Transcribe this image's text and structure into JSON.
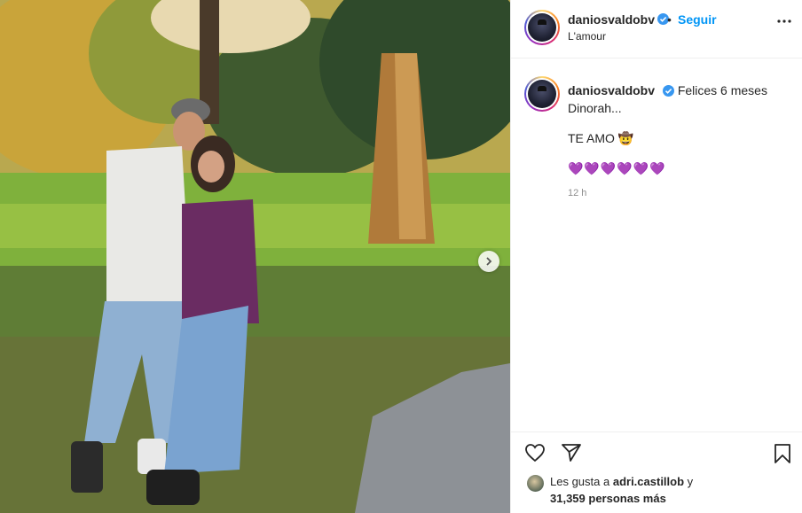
{
  "post": {
    "username": "daniosvaldobv",
    "location": "L'amour",
    "follow_separator": "•",
    "follow_label": "Seguir"
  },
  "caption": {
    "username": "daniosvaldobv",
    "line1": "Felices 6 meses Dinorah...",
    "line2": "TE AMO 🤠",
    "line3": "💜💜💜💜💜💜",
    "time": "12 h"
  },
  "likes": {
    "prefix": "Les gusta a",
    "user": "adri.castillob",
    "joiner": "y",
    "count_text": "31,359 personas más"
  },
  "icons": {
    "verified": "verified-badge-icon",
    "more": "more-options-icon",
    "like": "heart-icon",
    "share": "paper-plane-icon",
    "save": "bookmark-icon",
    "next": "chevron-right-icon"
  },
  "colors": {
    "link_blue": "#0095f6",
    "verified_blue": "#3897f0",
    "border": "#efefef",
    "muted": "#8e8e8e"
  }
}
